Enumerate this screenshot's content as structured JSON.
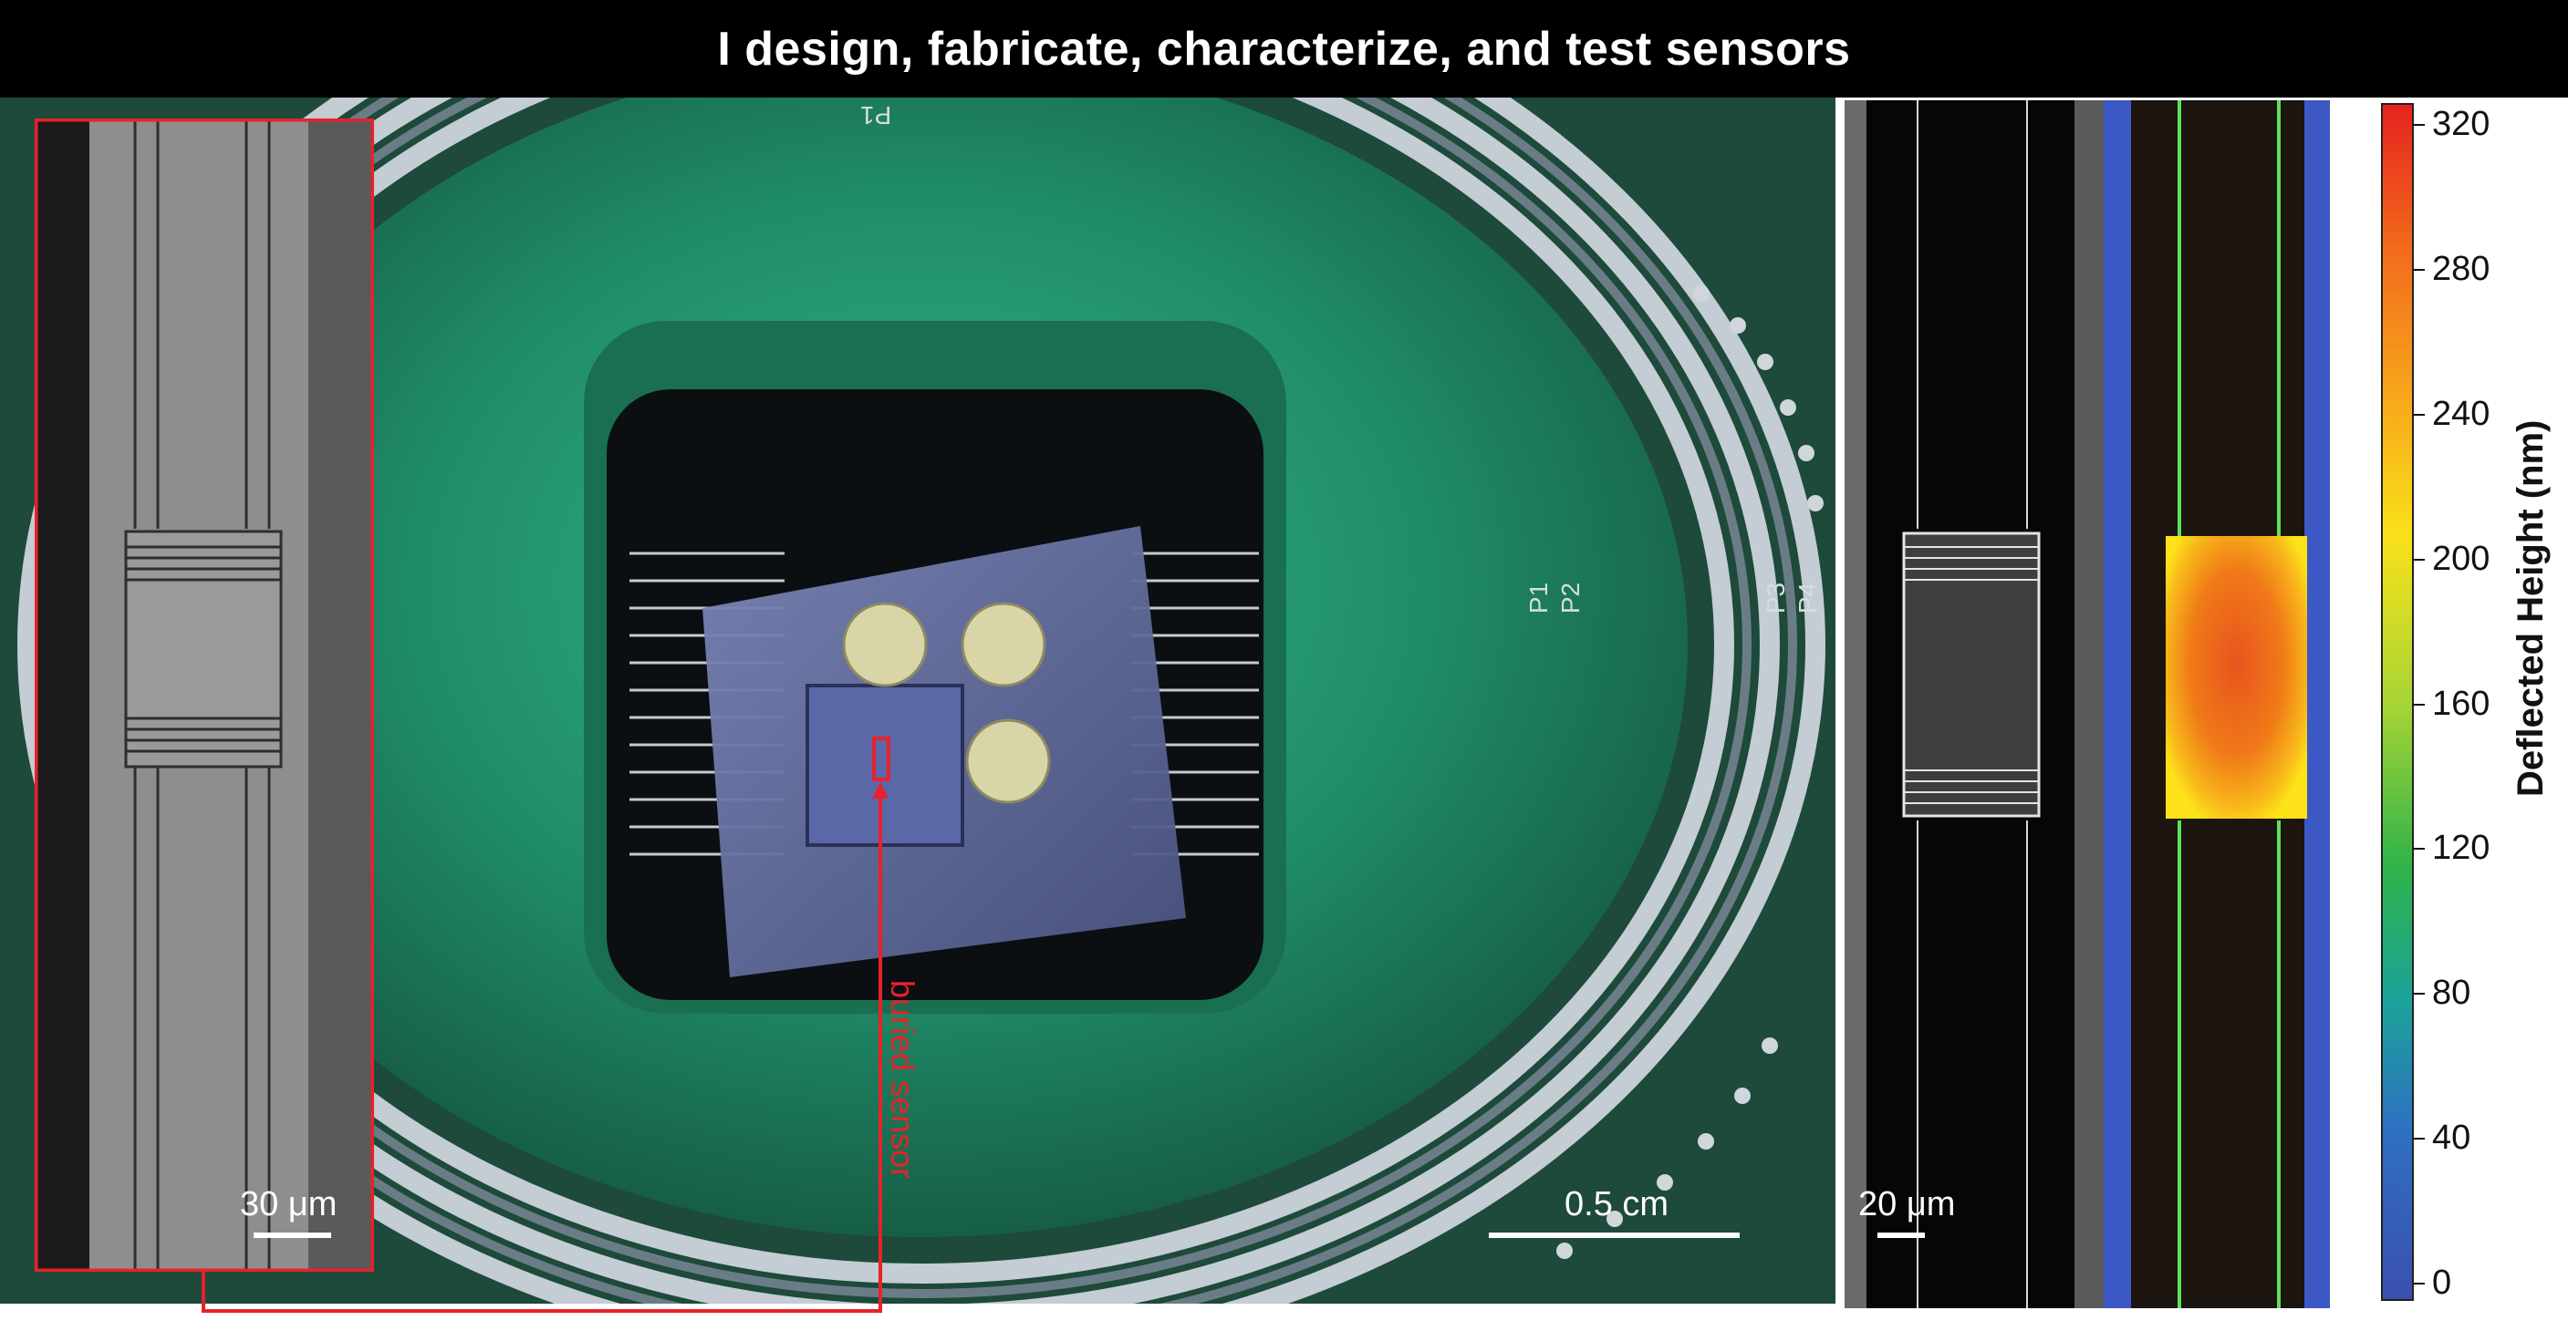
{
  "header": {
    "title": "I design, fabricate, characterize, and test sensors"
  },
  "annotations": {
    "buried_sensor": "buried sensor",
    "scale_left": "30 μm",
    "scale_center": "0.5 cm",
    "scale_right": "20 μm"
  },
  "board_labels": {
    "p1_top": "P1",
    "p1": "P1",
    "p2": "P2",
    "p3": "P3",
    "p4": "P4"
  },
  "colorbar": {
    "label": "Deflected Height (nm)",
    "ticks": [
      "320",
      "280",
      "240",
      "200",
      "160",
      "120",
      "80",
      "40",
      "0"
    ],
    "min": 0,
    "max": 320
  },
  "colors": {
    "highlight": "#e8222a",
    "pcb_green": "#1f5e48",
    "cavity_green": "#2ba87a",
    "trace_silver": "#c4ccd4"
  },
  "icons": [
    "sem-micrograph",
    "pcb-photo",
    "height-map",
    "colorbar"
  ]
}
